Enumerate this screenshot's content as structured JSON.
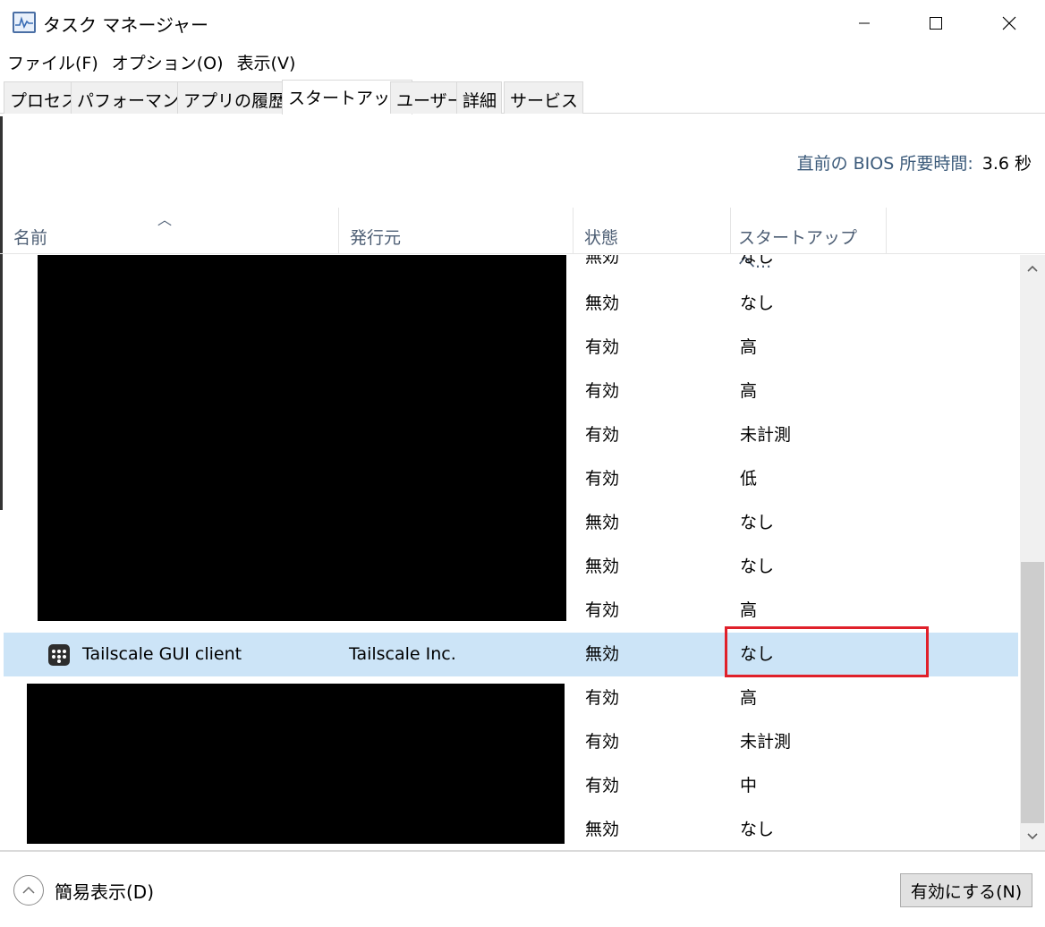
{
  "window": {
    "title": "タスク マネージャー"
  },
  "menu": [
    "ファイル(F)",
    "オプション(O)",
    "表示(V)"
  ],
  "tabs": [
    "プロセス",
    "パフォーマンス",
    "アプリの履歴",
    "スタートアップ",
    "ユーザー",
    "詳細",
    "サービス"
  ],
  "active_tab": "スタートアップ",
  "bios": {
    "label": "直前の BIOS 所要時間:",
    "value": "3.6 秒"
  },
  "columns": {
    "name": "名前",
    "publisher": "発行元",
    "status": "状態",
    "impact": "スタートアップへ..."
  },
  "rows": [
    {
      "status": "無効",
      "impact": "なし"
    },
    {
      "status": "無効",
      "impact": "なし"
    },
    {
      "status": "有効",
      "impact": "高"
    },
    {
      "status": "有効",
      "impact": "高"
    },
    {
      "status": "有効",
      "impact": "未計測"
    },
    {
      "status": "有効",
      "impact": "低"
    },
    {
      "status": "無効",
      "impact": "なし"
    },
    {
      "status": "無効",
      "impact": "なし"
    },
    {
      "status": "有効",
      "impact": "高"
    },
    {
      "name": "Tailscale GUI client",
      "publisher": "Tailscale Inc.",
      "status": "無効",
      "impact": "なし",
      "selected": true
    },
    {
      "status": "有効",
      "impact": "高"
    },
    {
      "status": "有効",
      "impact": "未計測"
    },
    {
      "status": "有効",
      "impact": "中"
    },
    {
      "status": "無効",
      "impact": "なし"
    }
  ],
  "footer": {
    "fewer_details": "簡易表示(D)",
    "enable_button": "有効にする(N)"
  },
  "colors": {
    "selection": "#cce4f7",
    "highlight_box": "#e0202a",
    "header_text": "#4d5e74"
  }
}
